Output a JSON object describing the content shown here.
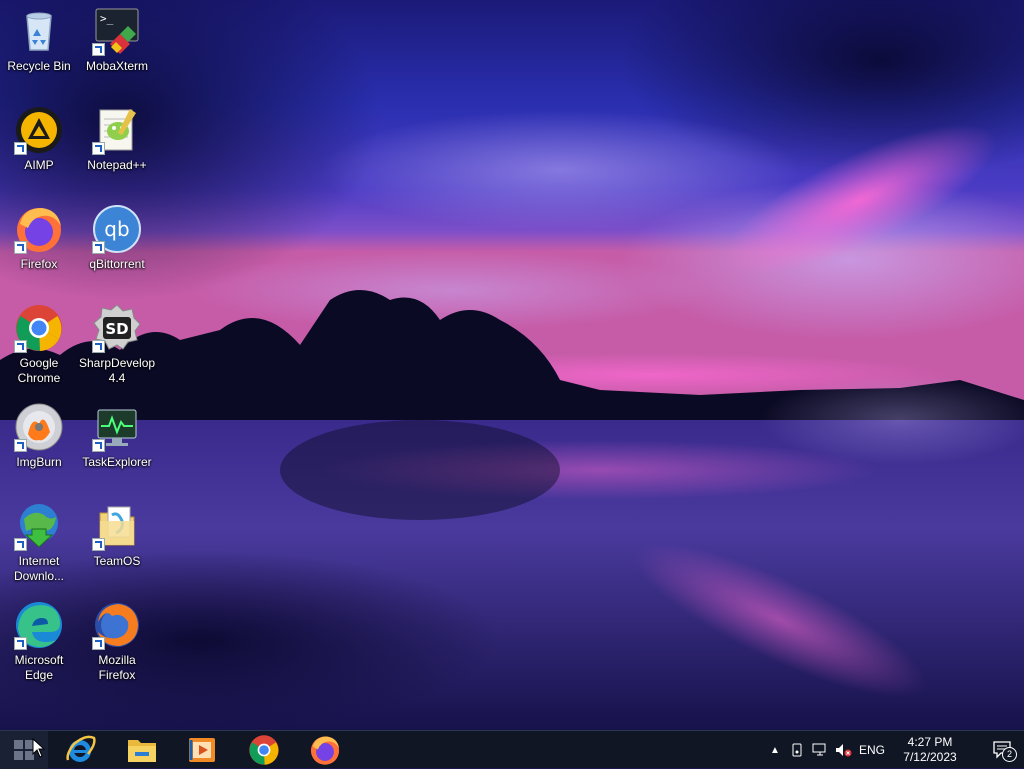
{
  "desktop": {
    "icons": [
      {
        "label": "Recycle Bin",
        "icon": "recycle-bin-icon"
      },
      {
        "label": "MobaXterm",
        "icon": "mobaxterm-icon"
      },
      {
        "label": "AIMP",
        "icon": "aimp-icon"
      },
      {
        "label": "Notepad++",
        "icon": "notepadpp-icon"
      },
      {
        "label": "Firefox",
        "icon": "firefox-icon"
      },
      {
        "label": "qBittorrent",
        "icon": "qbittorrent-icon"
      },
      {
        "label": "Google Chrome",
        "icon": "chrome-icon"
      },
      {
        "label": "SharpDevelop 4.4",
        "icon": "sharpdevelop-icon"
      },
      {
        "label": "ImgBurn",
        "icon": "imgburn-icon"
      },
      {
        "label": "TaskExplorer",
        "icon": "taskexplorer-icon"
      },
      {
        "label": "Internet Downlo...",
        "icon": "internet-download-manager-icon"
      },
      {
        "label": "TeamOS",
        "icon": "teamos-icon"
      },
      {
        "label": "Microsoft Edge",
        "icon": "edge-icon"
      },
      {
        "label": "Mozilla Firefox",
        "icon": "mozilla-firefox-icon"
      }
    ]
  },
  "taskbar": {
    "start": "windows-start-icon",
    "pinned": [
      {
        "icon": "internet-explorer-icon"
      },
      {
        "icon": "file-explorer-icon"
      },
      {
        "icon": "media-player-icon"
      },
      {
        "icon": "chrome-icon"
      },
      {
        "icon": "firefox-icon"
      }
    ],
    "tray": {
      "language": "ENG",
      "time": "4:27 PM",
      "date": "7/12/2023",
      "notifications_count": "2"
    }
  }
}
